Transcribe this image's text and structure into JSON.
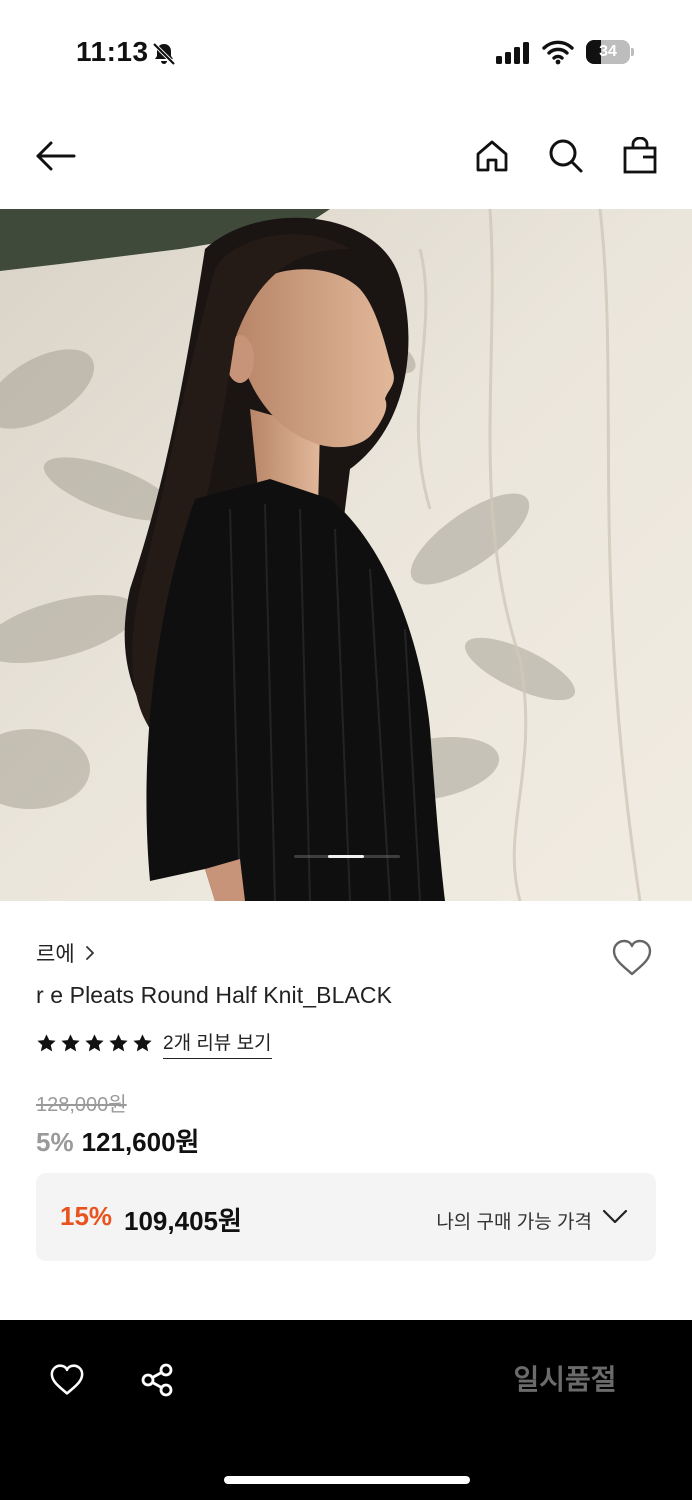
{
  "status_bar": {
    "time": "11:13",
    "battery": "34",
    "battery_level": 0.34,
    "icons": [
      "bell-slash-icon",
      "cellular-signal-icon",
      "wifi-icon",
      "battery-icon"
    ]
  },
  "nav": {
    "icons": [
      "back-arrow-icon",
      "home-icon",
      "search-icon",
      "shopping-bag-icon"
    ]
  },
  "gallery": {
    "image_description": "model in black short-sleeve ribbed knit in front of white draped fabric",
    "current_index_fraction": 0.66
  },
  "product": {
    "brand": "르에",
    "name": "r e Pleats Round Half Knit_BLACK",
    "rating_stars": 5,
    "review_link": "2개 리뷰 보기",
    "original_price": "128,000원",
    "discount_rate": "5%",
    "sale_price": "121,600원"
  },
  "my_price": {
    "discount_rate": "15%",
    "price": "109,405원",
    "label": "나의 구매 가능 가격"
  },
  "bottom_bar": {
    "status_button": "일시품절",
    "icons": [
      "heart-icon",
      "share-icon"
    ]
  },
  "colors": {
    "accent_discount": "#e8531e",
    "bottom_bar_bg": "#000000",
    "price_box_bg": "#f4f4f4"
  }
}
